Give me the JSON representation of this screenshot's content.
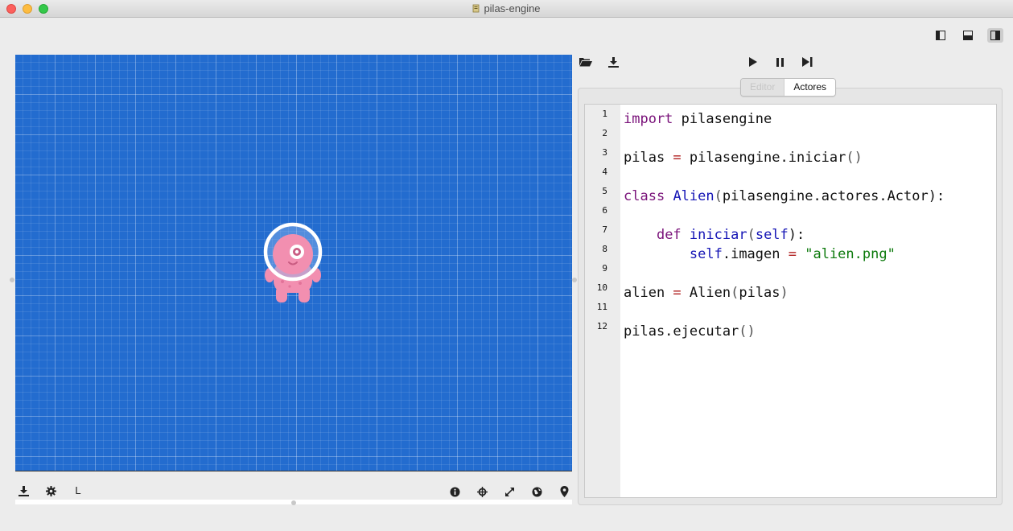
{
  "window": {
    "title": "pilas-engine"
  },
  "layout_buttons": [
    "layout-left-panel-icon",
    "layout-bottom-panel-icon",
    "layout-right-panel-icon"
  ],
  "stage": {
    "background": "#236ccf",
    "actor": "alien-icon"
  },
  "stage_toolbar": {
    "left": [
      "download-icon",
      "gear-icon"
    ],
    "letter": "L",
    "right": [
      "info-icon",
      "crosshair-icon",
      "fullscreen-icon",
      "globe-icon",
      "location-pin-icon"
    ]
  },
  "editor_toolbar": {
    "left": [
      "folder-open-icon",
      "download-icon"
    ],
    "center": [
      "play-icon",
      "pause-icon",
      "step-icon"
    ]
  },
  "tabs": [
    {
      "label": "Editor",
      "active": false
    },
    {
      "label": "Actores",
      "active": true
    }
  ],
  "code": {
    "line_numbers": [
      "1",
      "2",
      "3",
      "4",
      "5",
      "6",
      "7",
      "8",
      "9",
      "10",
      "11",
      "12"
    ],
    "lines": [
      [
        {
          "t": "import",
          "c": "kw"
        },
        {
          "t": " pilasengine",
          "c": ""
        }
      ],
      [],
      [
        {
          "t": "pilas ",
          "c": ""
        },
        {
          "t": "=",
          "c": "op"
        },
        {
          "t": " pilasengine.iniciar",
          "c": ""
        },
        {
          "t": "()",
          "c": "pn"
        }
      ],
      [],
      [
        {
          "t": "class",
          "c": "kw"
        },
        {
          "t": " ",
          "c": ""
        },
        {
          "t": "Alien",
          "c": "fn"
        },
        {
          "t": "(",
          "c": "pn"
        },
        {
          "t": "pilasengine.actores.Actor",
          "c": ""
        },
        {
          "t": "):",
          "c": ""
        }
      ],
      [],
      [
        {
          "t": "    ",
          "c": ""
        },
        {
          "t": "def",
          "c": "kw"
        },
        {
          "t": " ",
          "c": ""
        },
        {
          "t": "iniciar",
          "c": "fn"
        },
        {
          "t": "(",
          "c": "pn"
        },
        {
          "t": "self",
          "c": "slf"
        },
        {
          "t": "):",
          "c": ""
        }
      ],
      [
        {
          "t": "        ",
          "c": ""
        },
        {
          "t": "self",
          "c": "slf"
        },
        {
          "t": ".imagen ",
          "c": ""
        },
        {
          "t": "=",
          "c": "op"
        },
        {
          "t": " ",
          "c": ""
        },
        {
          "t": "\"alien.png\"",
          "c": "str"
        }
      ],
      [],
      [
        {
          "t": "alien ",
          "c": ""
        },
        {
          "t": "=",
          "c": "op"
        },
        {
          "t": " Alien",
          "c": ""
        },
        {
          "t": "(",
          "c": "pn"
        },
        {
          "t": "pilas",
          "c": ""
        },
        {
          "t": ")",
          "c": "pn"
        }
      ],
      [],
      [
        {
          "t": "pilas.ejecutar",
          "c": ""
        },
        {
          "t": "()",
          "c": "pn"
        }
      ]
    ]
  }
}
